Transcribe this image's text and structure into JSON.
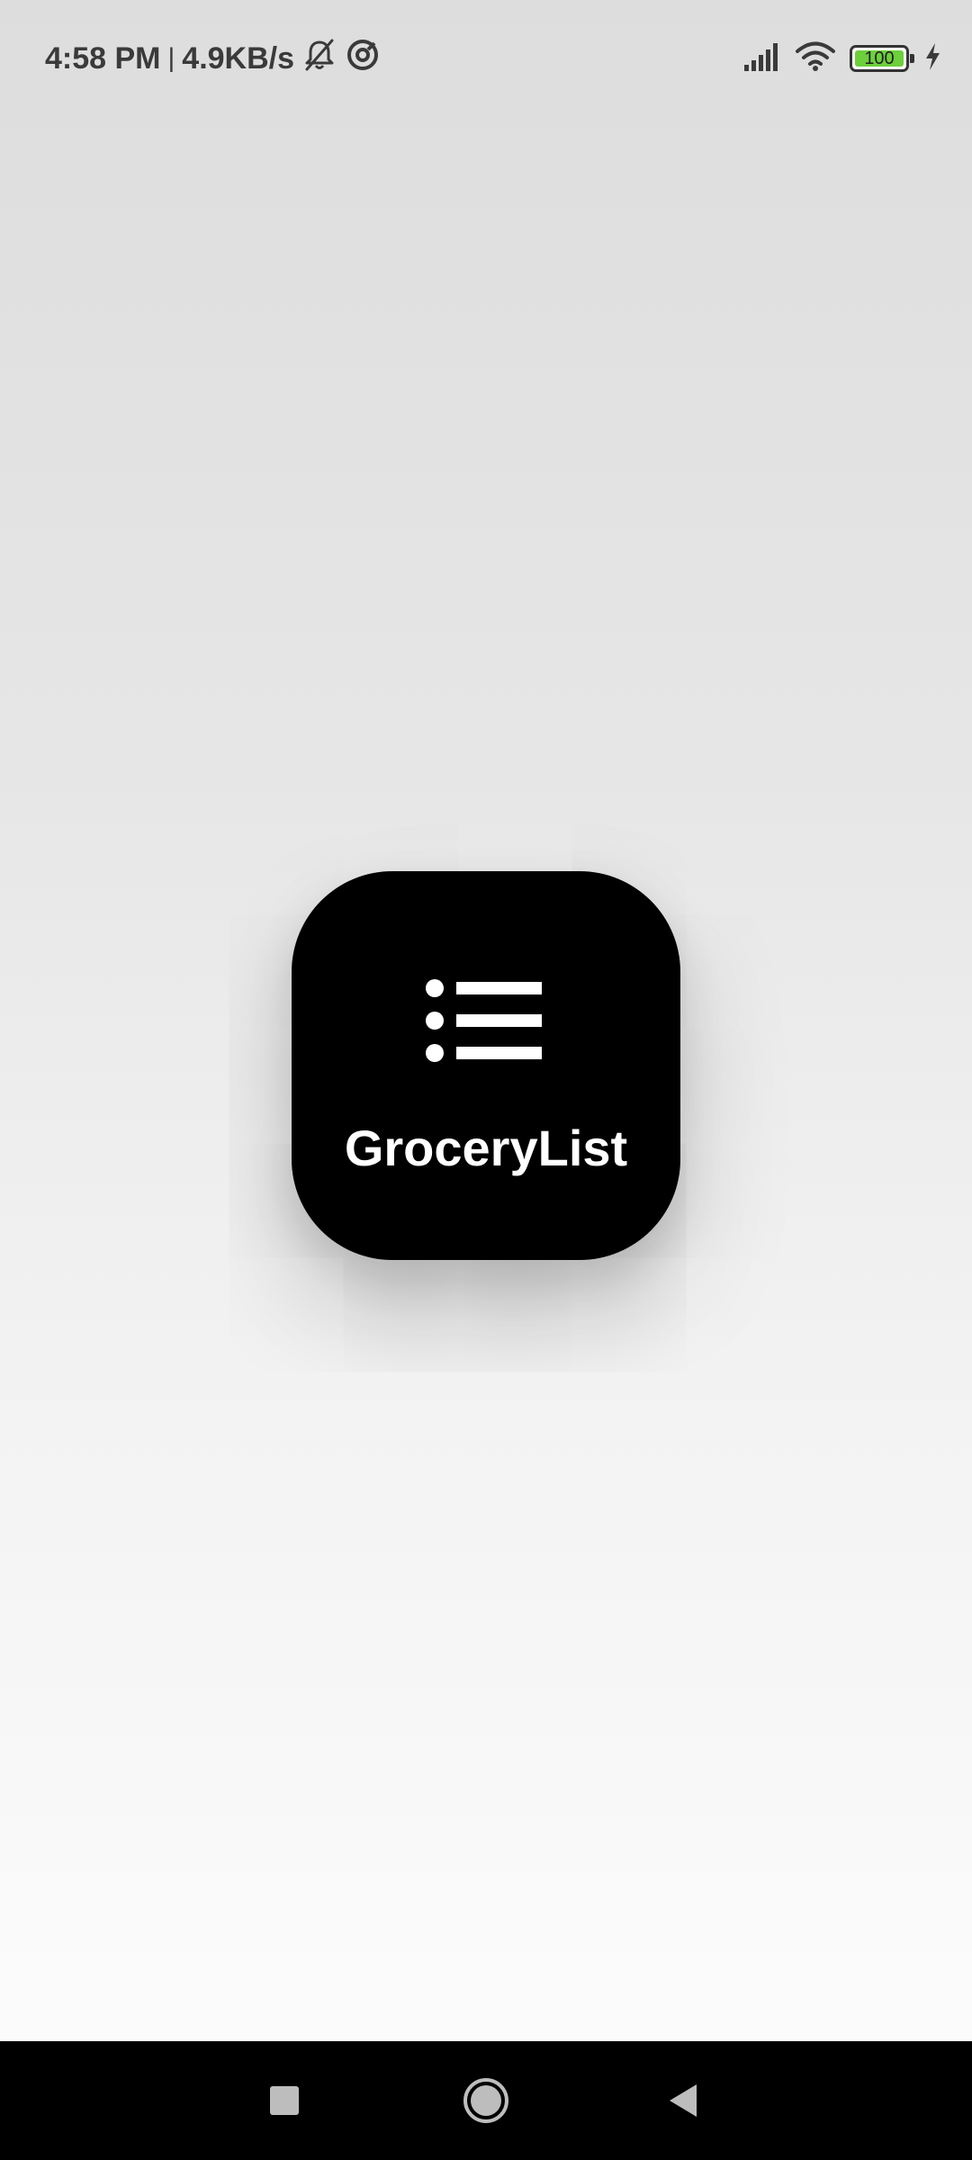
{
  "status_bar": {
    "time": "4:58 PM",
    "separator": "|",
    "network_speed": "4.9KB/s",
    "battery_level": "100",
    "icons": [
      "mute-bell-icon",
      "data-saver-icon",
      "signal-icon",
      "wifi-icon",
      "battery-icon",
      "charging-icon"
    ],
    "battery_color": "#6ccf3b"
  },
  "app": {
    "name": "GroceryList",
    "icon": "list-icon",
    "background_color": "#000000",
    "text_color": "#ffffff"
  },
  "nav_bar": {
    "buttons": [
      "recents-button",
      "home-button",
      "back-button"
    ]
  }
}
